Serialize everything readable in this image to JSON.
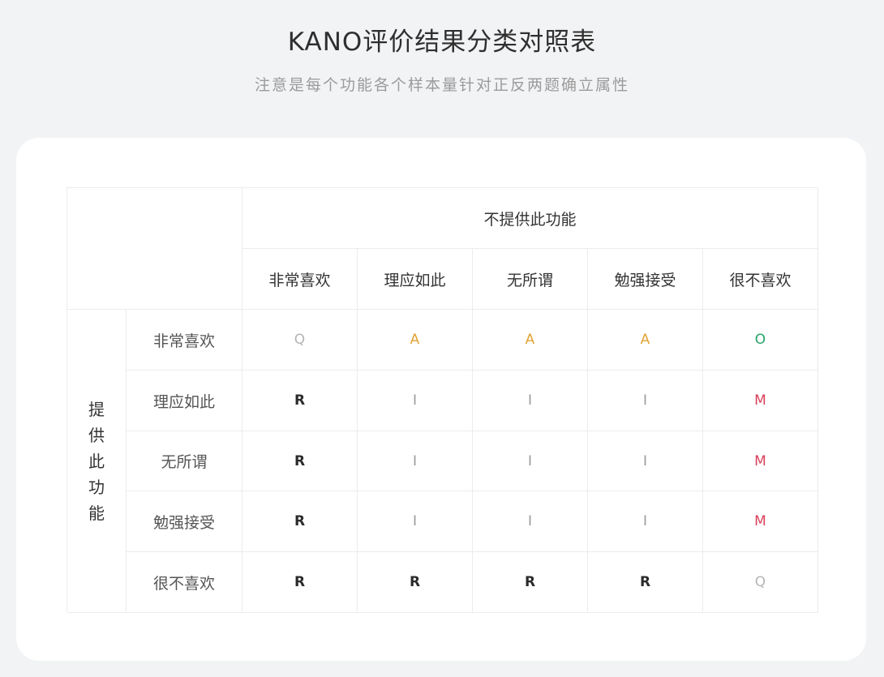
{
  "title": "KANO评价结果分类对照表",
  "subtitle": "注意是每个功能各个样本量针对正反两题确立属性",
  "table": {
    "col_group_label": "不提供此功能",
    "row_group_label": "提供此功能",
    "columns": [
      "非常喜欢",
      "理应如此",
      "无所谓",
      "勉强接受",
      "很不喜欢"
    ],
    "rows": [
      {
        "label": "非常喜欢",
        "values": [
          "Q",
          "A",
          "A",
          "A",
          "O"
        ]
      },
      {
        "label": "理应如此",
        "values": [
          "R",
          "I",
          "I",
          "I",
          "M"
        ]
      },
      {
        "label": "无所谓",
        "values": [
          "R",
          "I",
          "I",
          "I",
          "M"
        ]
      },
      {
        "label": "勉强接受",
        "values": [
          "R",
          "I",
          "I",
          "I",
          "M"
        ]
      },
      {
        "label": "很不喜欢",
        "values": [
          "R",
          "R",
          "R",
          "R",
          "Q"
        ]
      }
    ]
  },
  "colors": {
    "A": "#e3a233",
    "O": "#27a36b",
    "M": "#d9405a",
    "Q": "#b5b5b5",
    "R": "#2b2b2b",
    "I": "#9a9a9a"
  }
}
